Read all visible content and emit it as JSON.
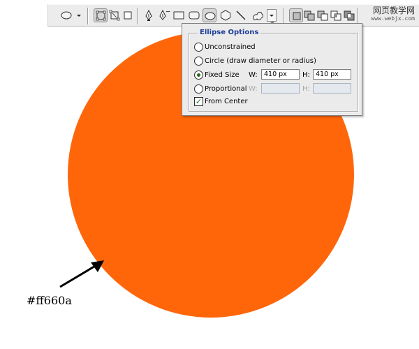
{
  "colors": {
    "circle_fill": "#ff660a",
    "arrow": "#000000"
  },
  "toolbar": {
    "tools": [
      {
        "name": "ellipse-preset-picker",
        "icon": "ellipse-icon"
      },
      {
        "name": "shape-layers-mode",
        "icon": "shape-layers-icon"
      },
      {
        "name": "paths-mode",
        "icon": "paths-icon"
      },
      {
        "name": "fill-pixels-mode",
        "icon": "fill-pixels-icon"
      },
      {
        "name": "pen-tool",
        "icon": "pen-icon"
      },
      {
        "name": "freeform-pen-tool",
        "icon": "freeform-pen-icon"
      },
      {
        "name": "rectangle-tool",
        "icon": "rectangle-icon"
      },
      {
        "name": "rounded-rectangle-tool",
        "icon": "rounded-rectangle-icon"
      },
      {
        "name": "ellipse-tool",
        "icon": "ellipse-icon",
        "active": true
      },
      {
        "name": "polygon-tool",
        "icon": "polygon-icon"
      },
      {
        "name": "line-tool",
        "icon": "line-icon"
      },
      {
        "name": "custom-shape-tool",
        "icon": "custom-shape-icon"
      },
      {
        "name": "geometry-options-dropdown",
        "icon": "chevron-down-icon"
      },
      {
        "name": "create-new-shape-layer",
        "icon": "new-shape-icon",
        "active": true
      },
      {
        "name": "add-to-shape-area",
        "icon": "add-area-icon"
      },
      {
        "name": "subtract-from-shape-area",
        "icon": "subtract-area-icon"
      },
      {
        "name": "intersect-shape-areas",
        "icon": "intersect-area-icon"
      },
      {
        "name": "exclude-overlapping-shape-areas",
        "icon": "exclude-area-icon"
      }
    ]
  },
  "watermark": {
    "main": "网页教学网",
    "sub": "www.webjx.com"
  },
  "ellipse_options": {
    "title": "Ellipse Options",
    "unconstrained": "Unconstrained",
    "circle": "Circle (draw diameter or radius)",
    "fixed_size": "Fixed Size",
    "proportional": "Proportional",
    "from_center": "From Center",
    "selected": "fixed_size",
    "from_center_checked": true,
    "w_label": "W:",
    "h_label": "H:",
    "fixed_w": "410 px",
    "fixed_h": "410 px",
    "prop_w": "",
    "prop_h": ""
  },
  "annotation": {
    "color_label": "#ff660a"
  }
}
